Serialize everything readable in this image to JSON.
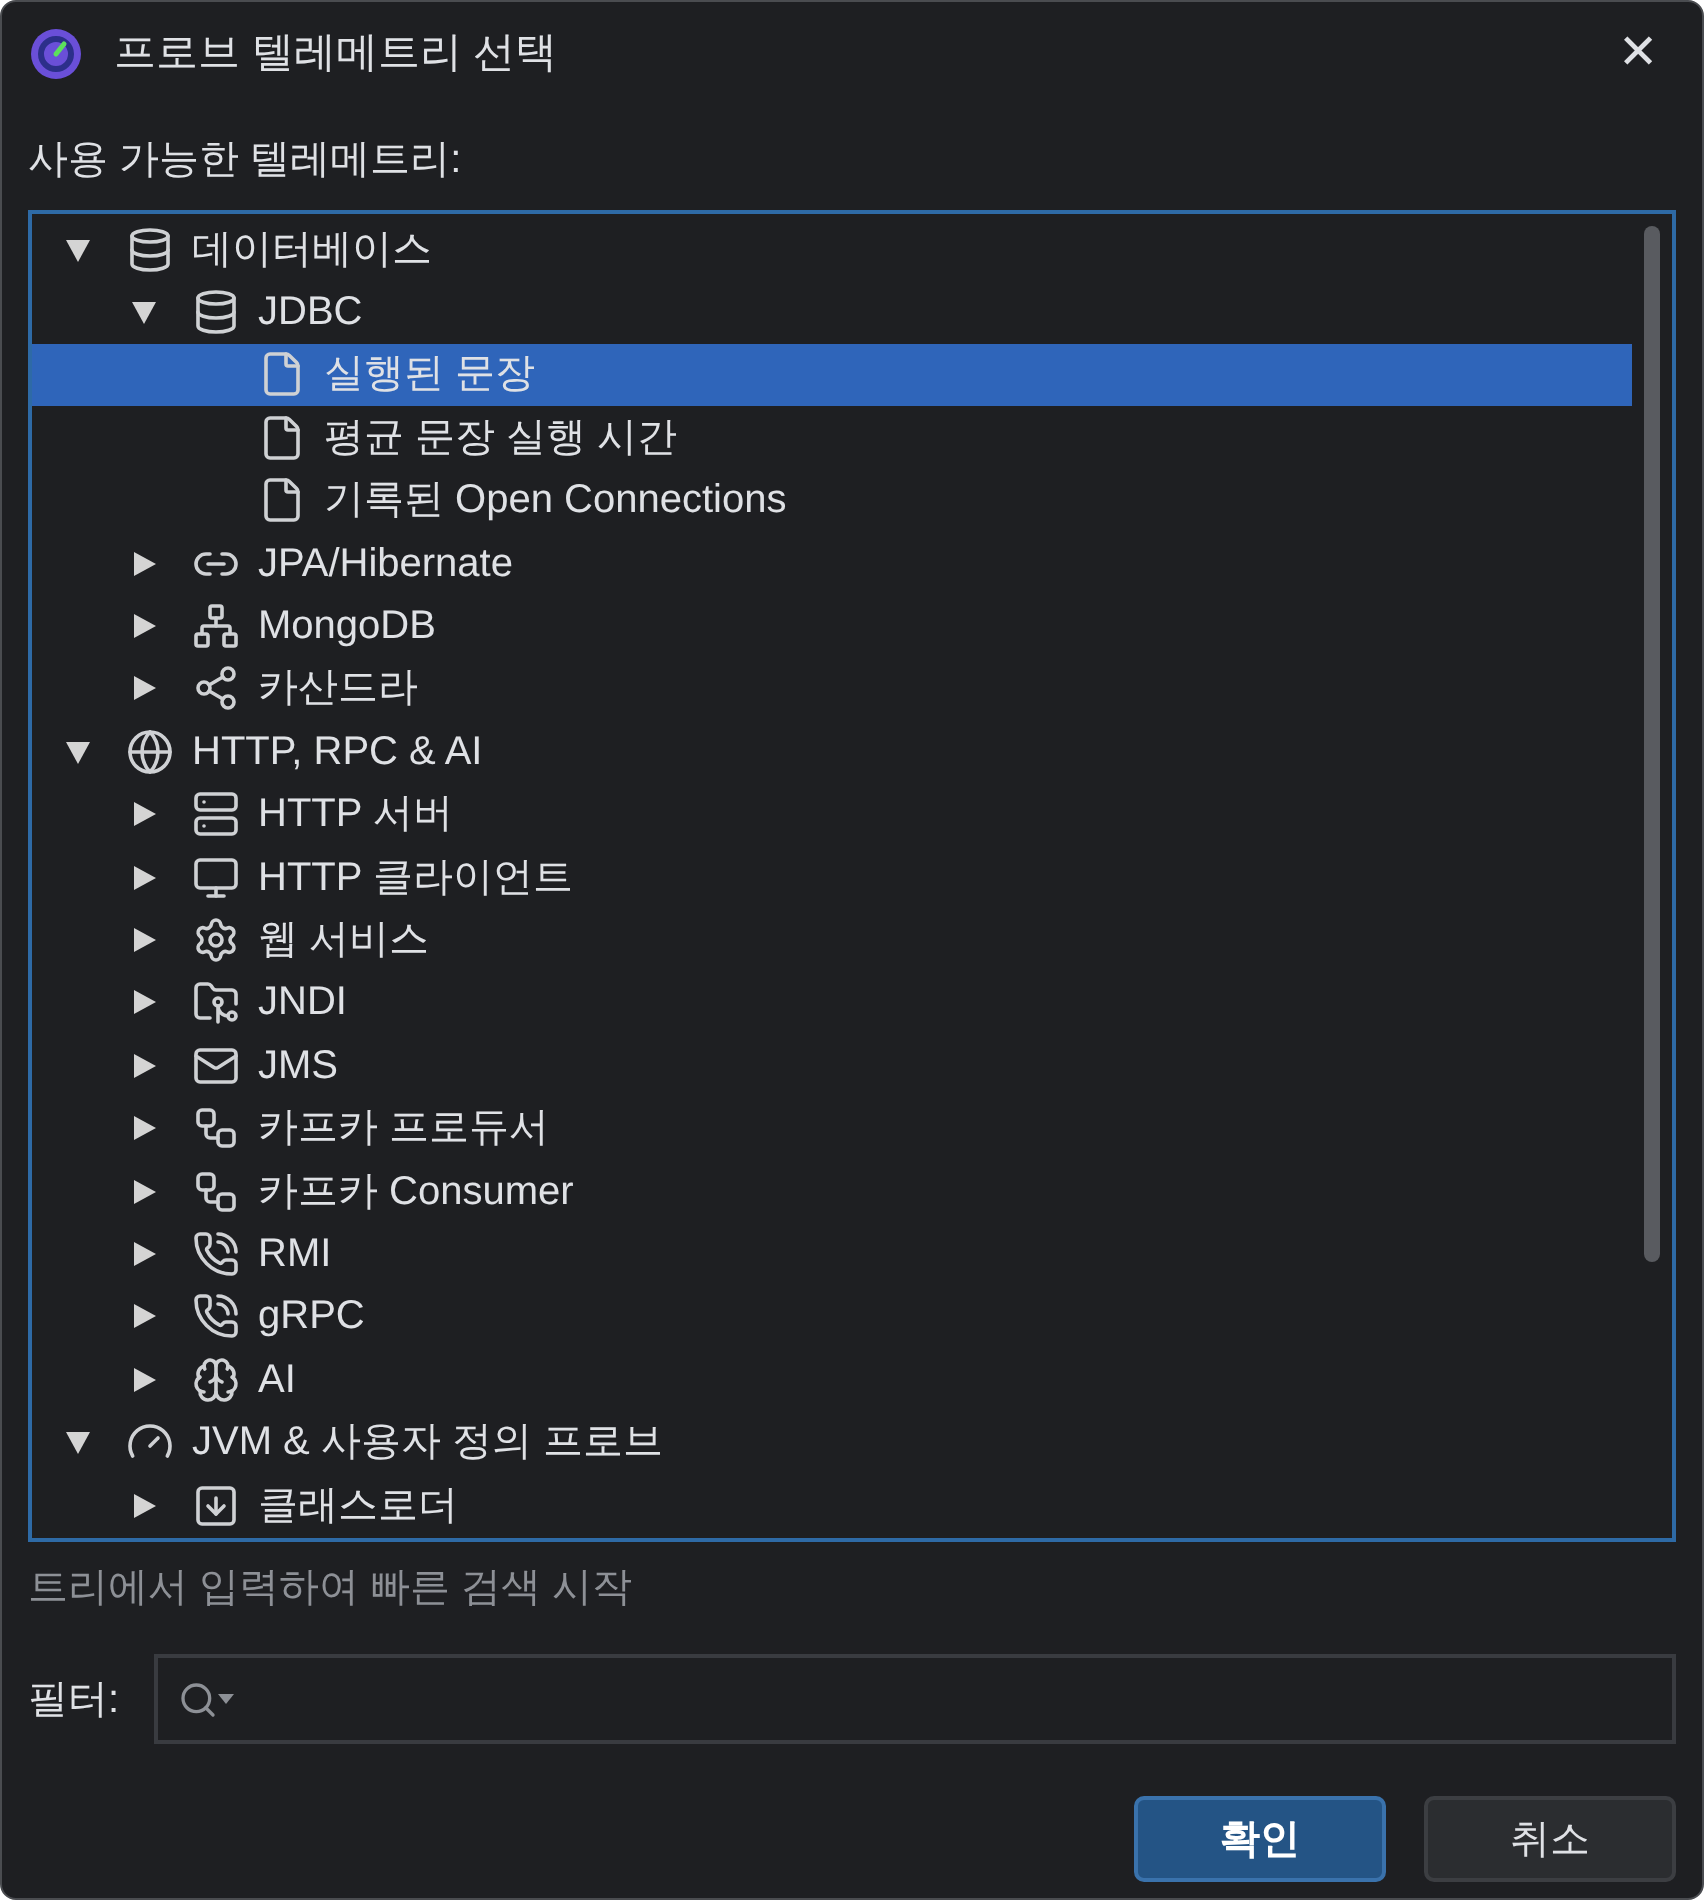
{
  "window": {
    "title": "프로브 텔레메트리 선택",
    "close": "✕"
  },
  "tree_label": "사용 가능한 텔레메트리:",
  "tree": [
    {
      "label": "데이터베이스",
      "kind": "database",
      "expanded": true,
      "selected": false,
      "children": [
        {
          "label": "JDBC",
          "kind": "database",
          "expanded": true,
          "selected": false,
          "children": [
            {
              "label": "실행된 문장",
              "kind": "file",
              "selected": true
            },
            {
              "label": "평균 문장 실행 시간",
              "kind": "file",
              "selected": false
            },
            {
              "label": "기록된 Open Connections",
              "kind": "file",
              "selected": false
            }
          ]
        },
        {
          "label": "JPA/Hibernate",
          "kind": "orm",
          "expanded": false,
          "selected": false
        },
        {
          "label": "MongoDB",
          "kind": "hub",
          "expanded": false,
          "selected": false
        },
        {
          "label": "카산드라",
          "kind": "graph",
          "expanded": false,
          "selected": false
        }
      ]
    },
    {
      "label": "HTTP, RPC & AI",
      "kind": "globe",
      "expanded": true,
      "selected": false,
      "children": [
        {
          "label": "HTTP 서버",
          "kind": "server",
          "expanded": false,
          "selected": false
        },
        {
          "label": "HTTP 클라이언트",
          "kind": "client",
          "expanded": false,
          "selected": false
        },
        {
          "label": "웹 서비스",
          "kind": "webservice",
          "expanded": false,
          "selected": false
        },
        {
          "label": "JNDI",
          "kind": "folder",
          "expanded": false,
          "selected": false
        },
        {
          "label": "JMS",
          "kind": "mail",
          "expanded": false,
          "selected": false
        },
        {
          "label": "카프카 프로듀서",
          "kind": "kafka",
          "expanded": false,
          "selected": false
        },
        {
          "label": "카프카 Consumer",
          "kind": "kafka",
          "expanded": false,
          "selected": false
        },
        {
          "label": "RMI",
          "kind": "phone",
          "expanded": false,
          "selected": false
        },
        {
          "label": "gRPC",
          "kind": "phone",
          "expanded": false,
          "selected": false
        },
        {
          "label": "AI",
          "kind": "brain",
          "expanded": false,
          "selected": false
        }
      ]
    },
    {
      "label": "JVM & 사용자 정의 프로브",
      "kind": "gauge",
      "expanded": true,
      "selected": false,
      "children": [
        {
          "label": "클래스로더",
          "kind": "download",
          "expanded": false,
          "selected": false
        }
      ]
    }
  ],
  "hint": "트리에서 입력하여 빠른 검색 시작",
  "filter": {
    "label": "필터:"
  },
  "buttons": [
    {
      "label": "확인",
      "kind": "primary"
    },
    {
      "label": "취소",
      "kind": "secondary"
    }
  ]
}
